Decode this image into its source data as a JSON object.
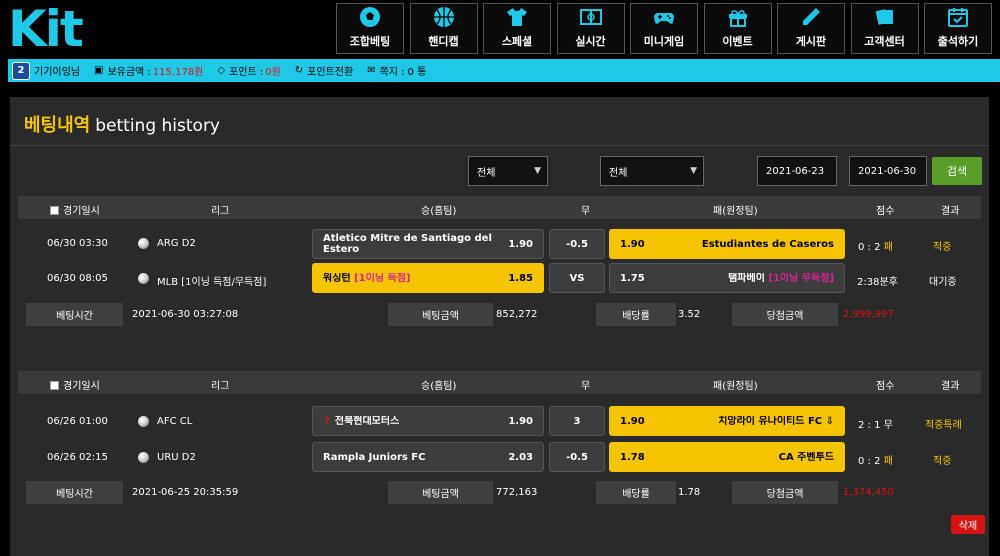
{
  "logo": "Kit",
  "nav": [
    {
      "label": "조합베팅",
      "icon": "soccer-ball-icon"
    },
    {
      "label": "핸디캡",
      "icon": "basketball-icon"
    },
    {
      "label": "스페셜",
      "icon": "jersey-icon"
    },
    {
      "label": "실시간",
      "icon": "field-icon"
    },
    {
      "label": "미니게임",
      "icon": "gamepad-icon"
    },
    {
      "label": "이벤트",
      "icon": "gift-icon"
    },
    {
      "label": "게시판",
      "icon": "pencil-icon"
    },
    {
      "label": "고객센터",
      "icon": "cards-icon"
    },
    {
      "label": "출석하기",
      "icon": "calendar-check-icon"
    }
  ],
  "infobar": {
    "username": "기기이잉님",
    "balance_label": "보유금액 :",
    "balance_value": "115,178원",
    "point_label": "포인트 :",
    "point_value": "0원",
    "point_convert": "포인트전환",
    "message_label": "쪽지 :",
    "message_value": "0 통",
    "accent": "#1ec8e6"
  },
  "page": {
    "title_ko": "베팅내역",
    "title_en": "betting history"
  },
  "filters": {
    "select1": "전체",
    "select2": "전체",
    "date_from": "2021-06-23",
    "date_to": "2021-06-30",
    "search": "검색"
  },
  "headers": {
    "date": "경기일시",
    "league": "리그",
    "home": "승(홈팀)",
    "draw": "무",
    "away": "패(원정팀)",
    "score": "점수",
    "result": "결과"
  },
  "bets": [
    {
      "games": [
        {
          "date": "06/30 03:30",
          "league": "ARG D2",
          "home": "Atletico Mitre de Santiago del Estero",
          "home_odds": "1.90",
          "draw": "-0.5",
          "away": "Estudiantes de Caseros",
          "away_odds": "1.90",
          "score": "0 : 2",
          "score_tag": "패",
          "result": "적중",
          "selected": "away"
        },
        {
          "date": "06/30 08:05",
          "league": "MLB [1이닝 득점/무득점]",
          "home": "워싱턴",
          "home_tag": "[1이닝 득점]",
          "home_odds": "1.85",
          "draw": "VS",
          "away": "탬파베이",
          "away_tag": "[1이닝 무득점]",
          "away_odds": "1.75",
          "score": "2:38분후",
          "score_tag": "",
          "result": "대기중",
          "selected": "home"
        }
      ],
      "summary": {
        "bet_time_label": "베팅시간",
        "bet_time": "2021-06-30 03:27:08",
        "amount_label": "베팅금액",
        "amount": "852,272",
        "odds_label": "배당률",
        "odds": "3.52",
        "win_label": "당첨금액",
        "win": "2,999,997"
      }
    },
    {
      "games": [
        {
          "date": "06/26 01:00",
          "league": "AFC CL",
          "home": "전북현대모터스",
          "home_odds": "1.90",
          "draw": "3",
          "away": "치앙라이 유나이티드 FC",
          "away_odds": "1.90",
          "score": "2 : 1",
          "score_tag": "무",
          "result": "적중특례",
          "selected": "away"
        },
        {
          "date": "06/26 02:15",
          "league": "URU D2",
          "home": "Rampla Juniors FC",
          "home_odds": "2.03",
          "draw": "-0.5",
          "away": "CA 주벤투드",
          "away_odds": "1.78",
          "score": "0 : 2",
          "score_tag": "패",
          "result": "적중",
          "selected": "away"
        }
      ],
      "summary": {
        "bet_time_label": "베팅시간",
        "bet_time": "2021-06-25 20:35:59",
        "amount_label": "베팅금액",
        "amount": "772,163",
        "odds_label": "배당률",
        "odds": "1.78",
        "win_label": "당첨금액",
        "win": "1,374,450"
      }
    }
  ],
  "delete": "삭제"
}
